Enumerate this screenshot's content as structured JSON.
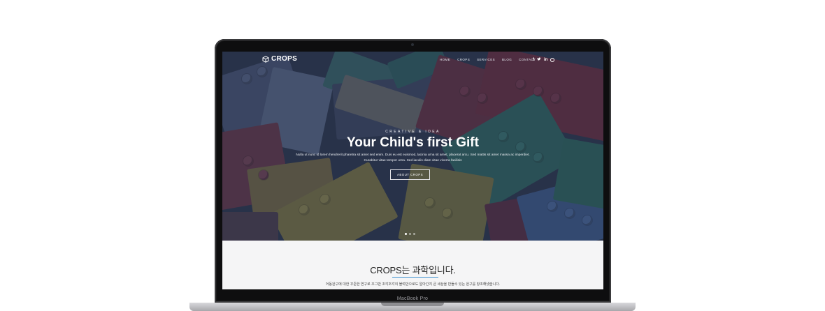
{
  "device": {
    "label": "MacBook Pro"
  },
  "header": {
    "logo": "CROPS",
    "menu": [
      "HOME",
      "CROPS",
      "SERVICES",
      "BLOG",
      "CONTACT"
    ],
    "social": [
      "f",
      "t",
      "in",
      "dribbble"
    ]
  },
  "hero": {
    "eyebrow": "CREATIVE & IDEA",
    "title": "Your Child's first Gift",
    "description": "Nulla ut nunc id lorem hendrerit pharetra sit amet sed enim. Duis eu est euismod, lacinia urna sit amet, placerat arcu. Sed mattis sit amet massa ac imperdiet. Curabitur vitae tempor urna. Sed iaculis diam vitae viverra facilisis",
    "button": "ABOUT CROPS",
    "slides": 3,
    "active_slide": 1
  },
  "about": {
    "title": "CROPS는 과학입니다.",
    "description": "어동완구에 대한 꾸준한 연구로 조그만 조각조각의 블럭만으로도 알아간지 큰 세상을 만들수 있는 완구를 창조해냈습니다."
  },
  "colors": {
    "accent": "#3b8fcf",
    "hero_overlay": "#283046"
  }
}
